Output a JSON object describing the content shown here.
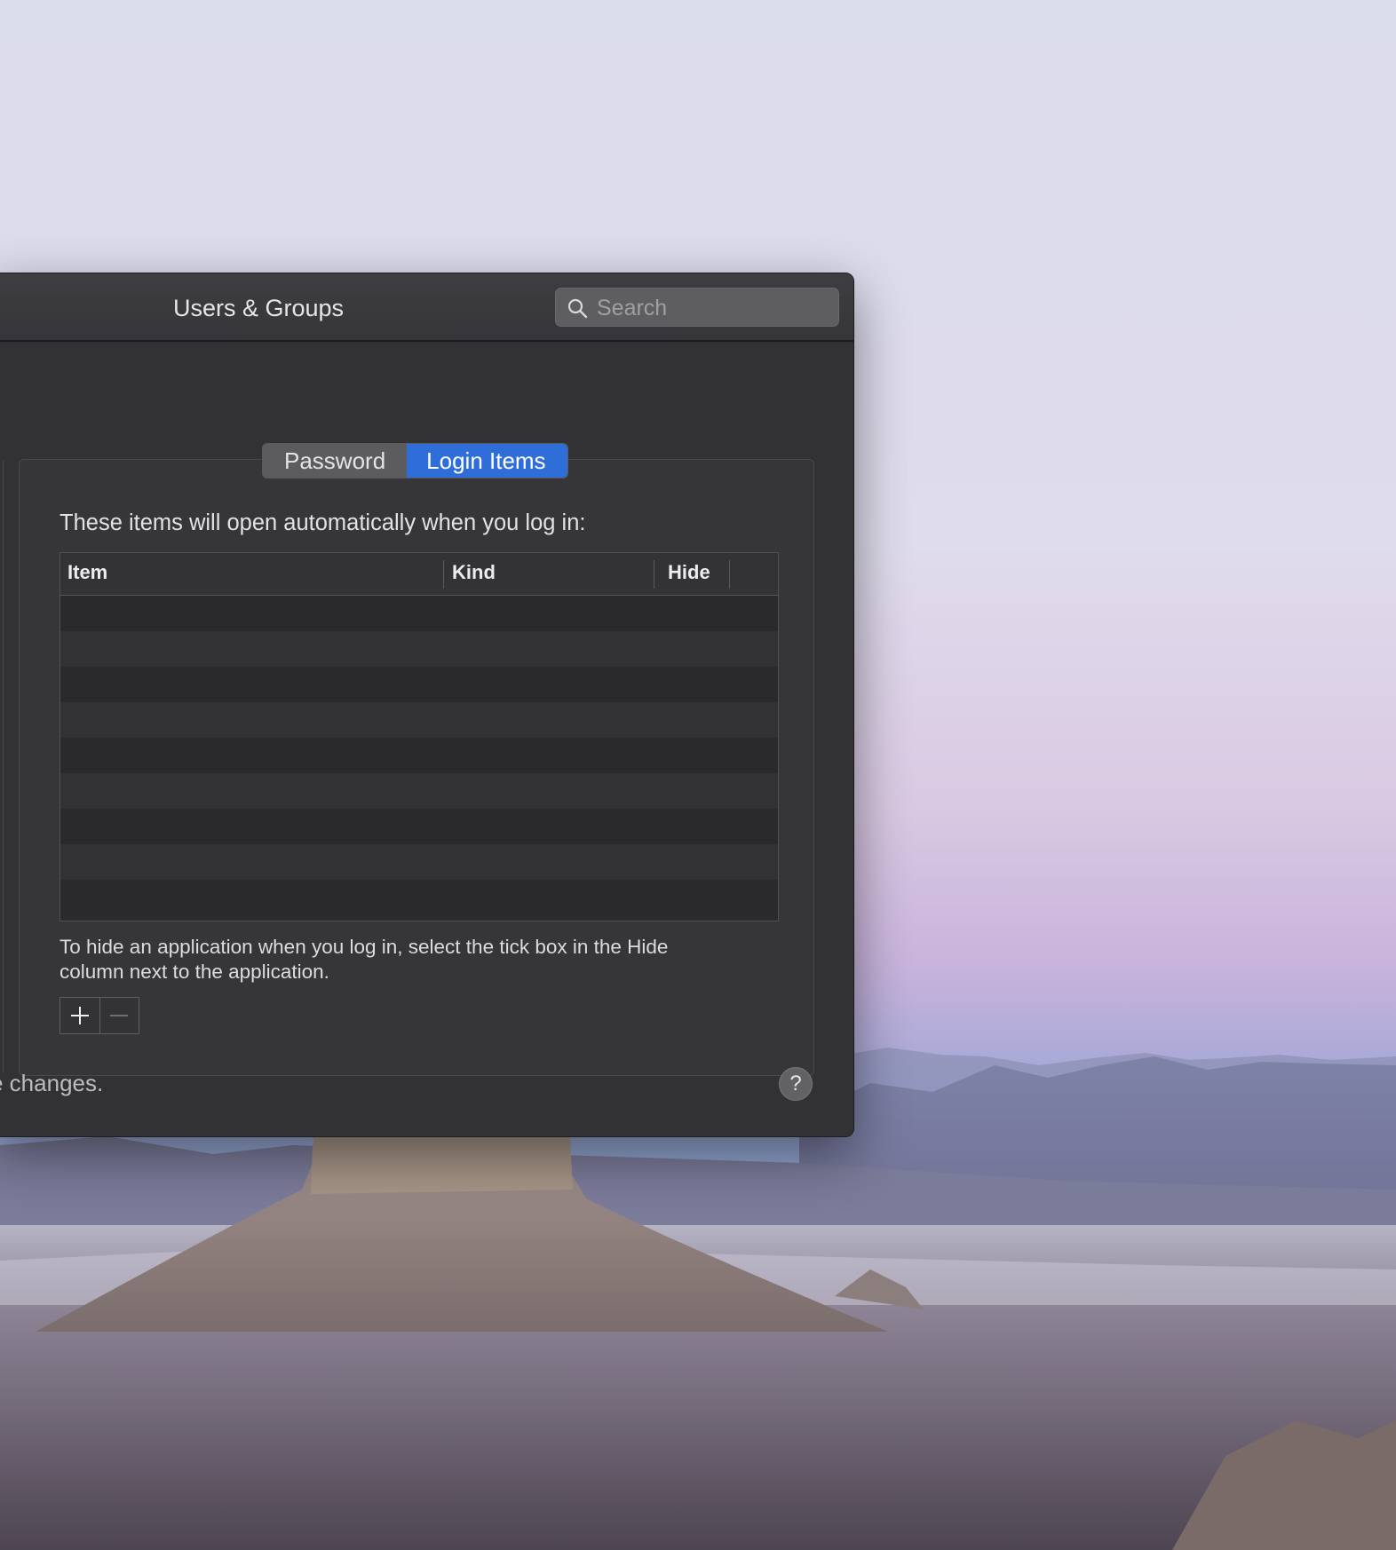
{
  "window": {
    "title": "Users & Groups",
    "search": {
      "placeholder": "Search",
      "value": ""
    }
  },
  "tabs": [
    {
      "label": "Password",
      "selected": false
    },
    {
      "label": "Login Items",
      "selected": true
    }
  ],
  "login_items": {
    "intro": "These items will open automatically when you log in:",
    "columns": [
      "Item",
      "Kind",
      "Hide"
    ],
    "rows": [],
    "hint": "To hide an application when you log in, select the tick box in the Hide column next to the application."
  },
  "buttons": {
    "add_icon": "plus-icon",
    "remove_icon": "minus-icon",
    "remove_enabled": false
  },
  "footer": {
    "text": "e changes.",
    "help": "?"
  },
  "colors": {
    "accent": "#2f6ed8",
    "window": "#333336",
    "titlebar": "#3c3c3f"
  }
}
